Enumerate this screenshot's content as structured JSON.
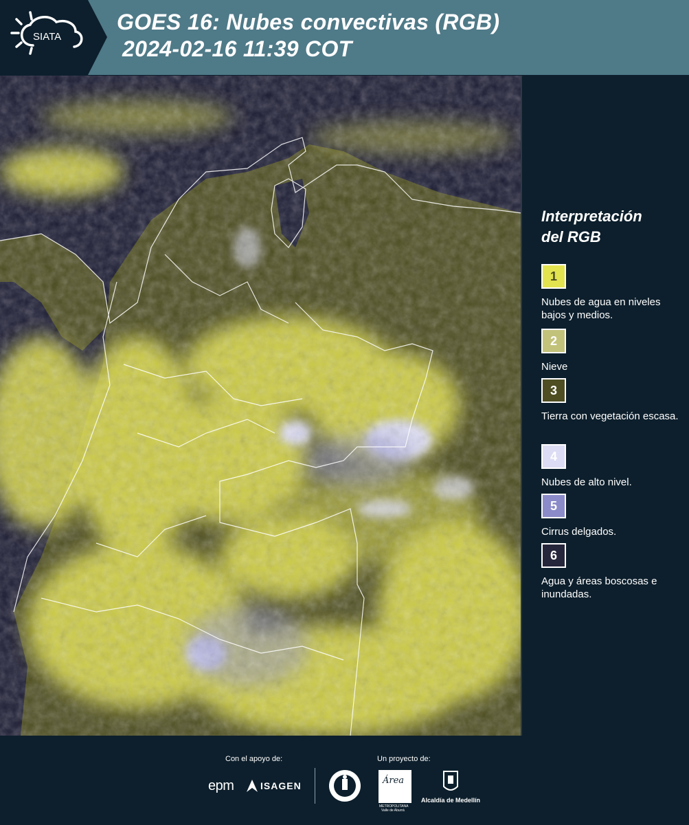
{
  "header": {
    "logo_text": "SIATA",
    "title_line1": "GOES 16: Nubes convectivas (RGB)",
    "title_line2": "2024-02-16 11:39 COT"
  },
  "legend": {
    "title_line1": "Interpretación",
    "title_line2": "del RGB",
    "items": [
      {
        "number": "1",
        "label": "Nubes de agua en niveles bajos y medios.",
        "color": "#e3e24f",
        "text_color": "#4a4a20"
      },
      {
        "number": "2",
        "label": "Nieve",
        "color": "#c2c27b",
        "text_color": "#ffffff"
      },
      {
        "number": "3",
        "label": "Tierra con vegetación escasa.",
        "color": "#4e4e22",
        "text_color": "#ffffff"
      },
      {
        "number": "4",
        "label": "Nubes de alto nivel.",
        "color": "#dcdcf4",
        "text_color": "#ffffff"
      },
      {
        "number": "5",
        "label": "Cirrus delgados.",
        "color": "#8b8bc9",
        "text_color": "#ffffff"
      },
      {
        "number": "6",
        "label": "Agua y áreas boscosas e inundadas.",
        "color": "#25253b",
        "text_color": "#ffffff"
      }
    ]
  },
  "footer": {
    "support_label": "Con el apoyo de:",
    "project_label": "Un proyecto de:",
    "sponsor_epm": "epm",
    "sponsor_isagen": "ISAGEN",
    "area_metro_line1": "METROPOLITANA",
    "area_metro_line2": "Valle de Aburrá",
    "area_script": "Área",
    "alcaldia": "Alcaldía de Medellín"
  },
  "colors": {
    "header_bg": "#4f7a88",
    "page_bg": "#0d1f2c",
    "cloud_yellow": "#e3e24f",
    "land_olive": "#4e4e22",
    "ocean": "#1b1b33",
    "high_cloud": "#dcdcf4"
  }
}
